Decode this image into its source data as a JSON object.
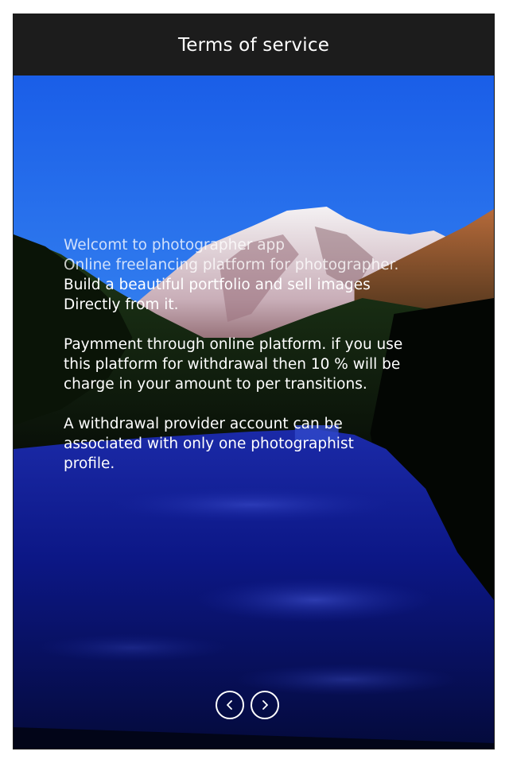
{
  "header": {
    "title": "Terms of service"
  },
  "terms": {
    "paragraphs": [
      {
        "lines": [
          "Welcomt to photographer app",
          "Online freelancing platform for photographer.",
          "Build a beautiful portfolio and sell images",
          "Directly from it."
        ]
      },
      {
        "lines": [
          "Paymment through online platform. if you use",
          "this platform for withdrawal  then 10 % will be",
          "charge in your amount to per transitions."
        ]
      },
      {
        "lines": [
          "A withdrawal provider account can be",
          "associated with only one photographist",
          "profile."
        ]
      }
    ]
  },
  "navigation": {
    "previous_icon": "chevron-left-icon",
    "next_icon": "chevron-right-icon"
  },
  "colors": {
    "header_bg": "#1c1c1c",
    "text": "#ffffff",
    "sky_top": "#1f5fe0",
    "river": "#0a1a8a"
  }
}
